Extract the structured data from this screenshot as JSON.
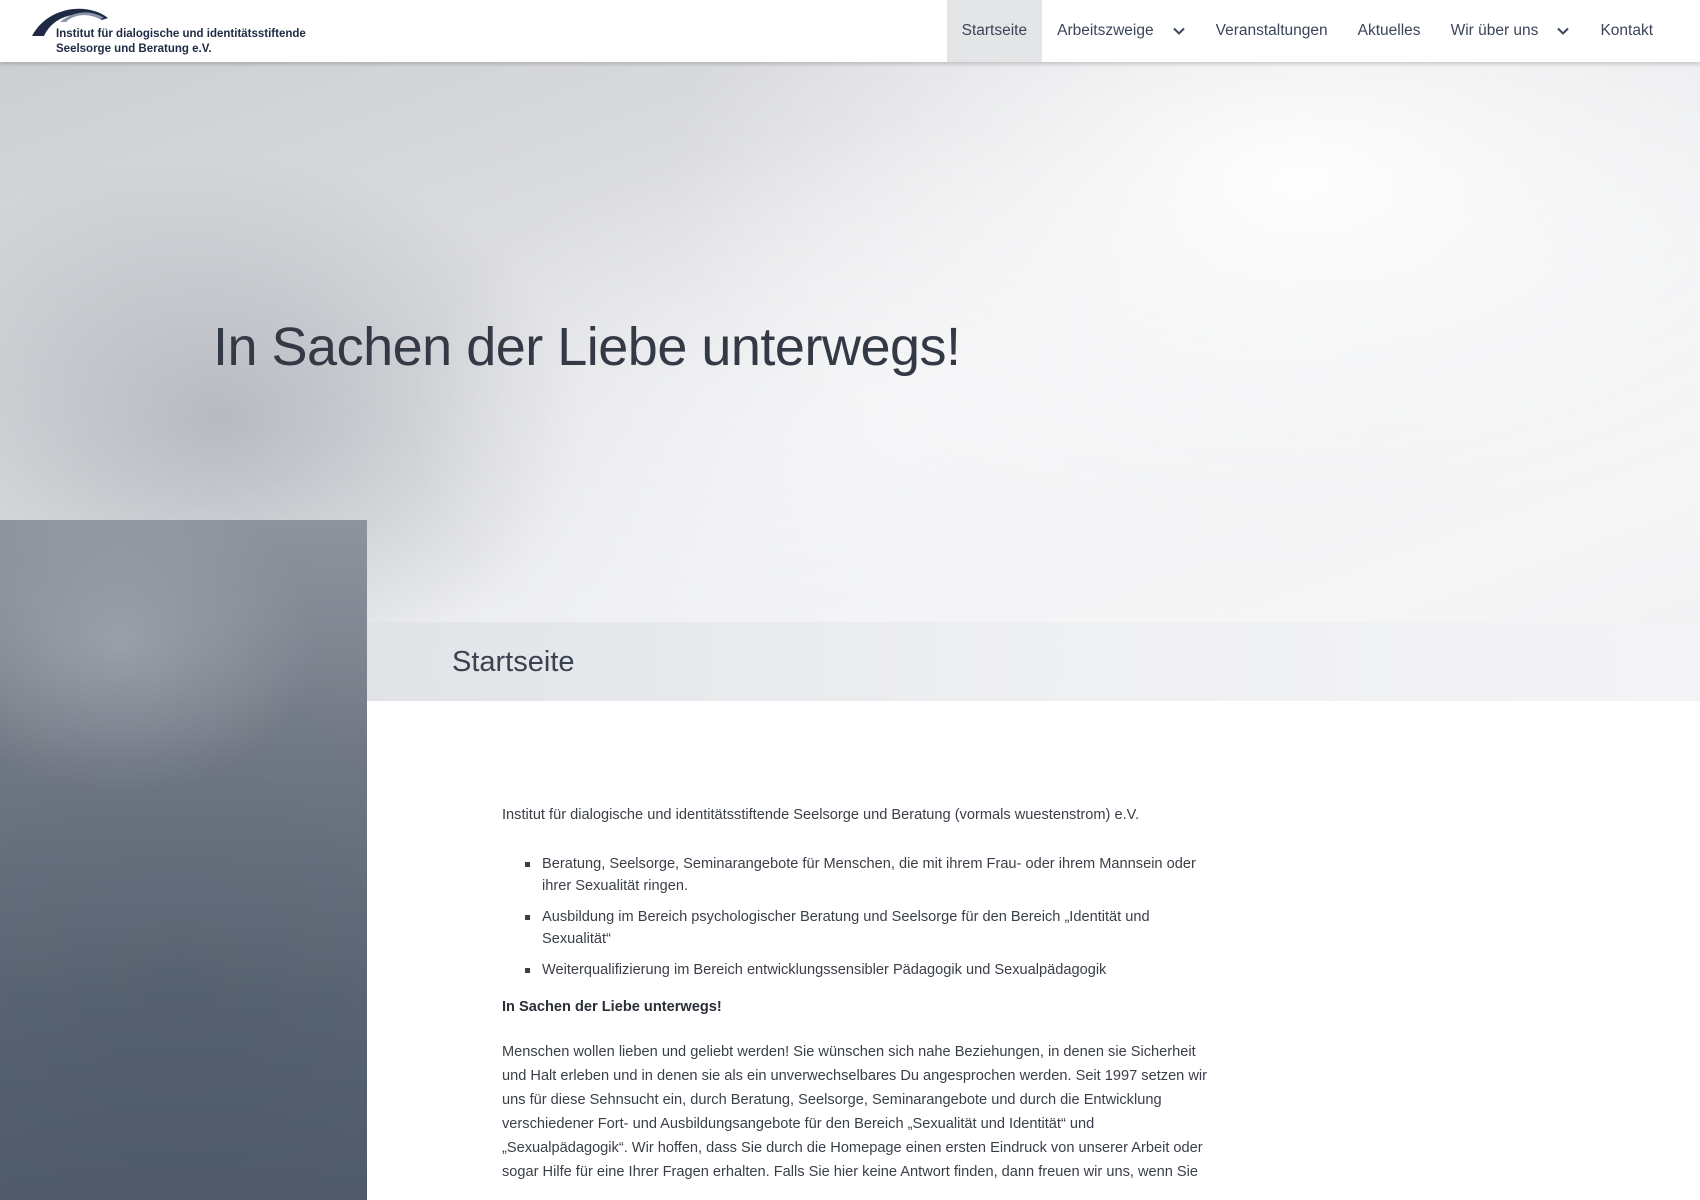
{
  "header": {
    "logo": {
      "line1": "Institut für dialogische und identitätsstiftende",
      "line2": "Seelsorge und Beratung e.V."
    },
    "nav": [
      {
        "label": "Startseite",
        "active": true,
        "has_dropdown": false
      },
      {
        "label": "Arbeitszweige",
        "active": false,
        "has_dropdown": true
      },
      {
        "label": "Veranstaltungen",
        "active": false,
        "has_dropdown": false
      },
      {
        "label": "Aktuelles",
        "active": false,
        "has_dropdown": false
      },
      {
        "label": "Wir über uns",
        "active": false,
        "has_dropdown": true
      },
      {
        "label": "Kontakt",
        "active": false,
        "has_dropdown": false
      }
    ]
  },
  "hero": {
    "title": "In Sachen der Liebe unterwegs!"
  },
  "page": {
    "title": "Startseite",
    "intro": "Institut für dialogische und identitätsstiftende Seelsorge und Beratung (vormals wuestenstrom) e.V.",
    "bullets": [
      "Beratung, Seelsorge, Seminarangebote für Menschen, die mit ihrem Frau- oder ihrem Mannsein oder ihrer Sexualität ringen.",
      "Ausbildung im Bereich psychologischer Beratung und Seelsorge für den Bereich „Identität und Sexualität“",
      "Weiterqualifizierung im Bereich entwicklungssensibler Pädagogik und Sexualpädagogik"
    ],
    "section_heading": "In Sachen der Liebe unterwegs!",
    "body": "Menschen wollen lieben und geliebt werden! Sie wünschen sich nahe Beziehungen, in denen sie Sicherheit und Halt erleben und in denen sie als ein unverwechselbares Du angesprochen werden. Seit 1997 setzen wir uns für diese Sehnsucht ein, durch Beratung, Seelsorge, Seminarangebote und durch die Entwicklung verschiedener Fort- und Ausbildungsangebote für den Bereich „Sexualität und Identität“ und „Sexualpädagogik“. Wir hoffen, dass Sie durch die Homepage einen ersten Eindruck von unserer Arbeit oder sogar Hilfe für eine Ihrer Fragen erhalten. Falls Sie hier keine Antwort finden, dann freuen wir uns, wenn Sie"
  },
  "colors": {
    "brand_navy": "#1f2a44",
    "nav_text": "#3b4559",
    "nav_active_bg": "#e4e5e7"
  },
  "icons": {
    "dropdown": "chevron-down-icon",
    "logo_mark": "arc-logo-icon"
  }
}
